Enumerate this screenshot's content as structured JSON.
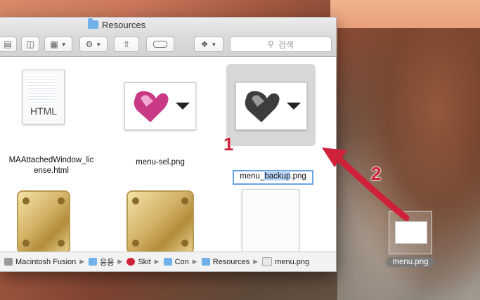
{
  "window": {
    "title": "Resources"
  },
  "toolbar": {
    "search_placeholder": "검색",
    "view_icons": [
      "list-view-icon",
      "cover-flow-icon",
      "grid-arrange-icon",
      "gear-icon",
      "share-icon",
      "tag-icon",
      "dropbox-icon"
    ]
  },
  "files": [
    {
      "name_line1": "MAAttachedWindow_lic",
      "name_line2": "ense.html",
      "type_label": "HTML"
    },
    {
      "name_line1": "menu-sel.png",
      "name_line2": ""
    },
    {
      "name_before": "menu_",
      "name_sel": "backup",
      "name_after": ".png"
    }
  ],
  "pathbar": {
    "items": [
      "Macintosh Fusion",
      "응용",
      "Skit",
      "Con",
      "Resources",
      "menu.png"
    ]
  },
  "drag": {
    "label": "menu.png"
  },
  "annotations": {
    "step1": "1",
    "step2": "2",
    "arrow_color": "#d0213b"
  }
}
